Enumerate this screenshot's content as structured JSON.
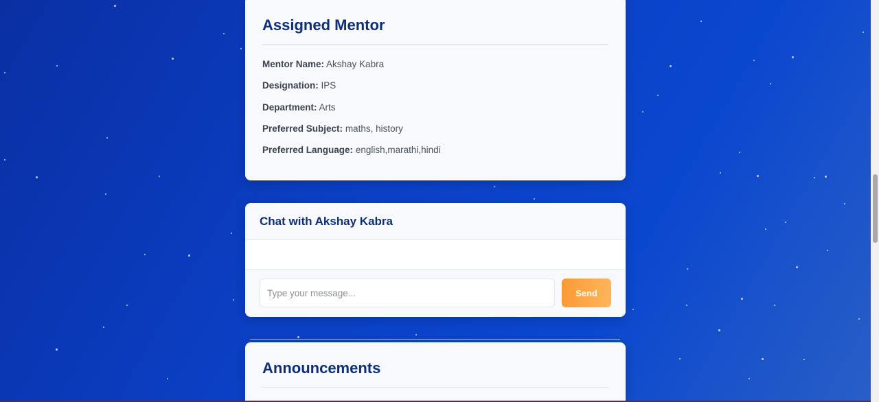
{
  "mentor": {
    "title": "Assigned Mentor",
    "details": [
      {
        "label": "Mentor Name:",
        "value": "Akshay Kabra"
      },
      {
        "label": "Designation:",
        "value": "IPS"
      },
      {
        "label": "Department:",
        "value": "Arts"
      },
      {
        "label": "Preferred Subject:",
        "value": "maths, history"
      },
      {
        "label": "Preferred Language:",
        "value": "english,marathi,hindi"
      }
    ]
  },
  "chat": {
    "title": "Chat with Akshay Kabra",
    "input_placeholder": "Type your message...",
    "input_value": "",
    "send_label": "Send"
  },
  "announcements": {
    "title": "Announcements"
  },
  "colors": {
    "background": "#0b3fc4",
    "heading": "#0d2f7a",
    "accent": "#fb9a36"
  }
}
